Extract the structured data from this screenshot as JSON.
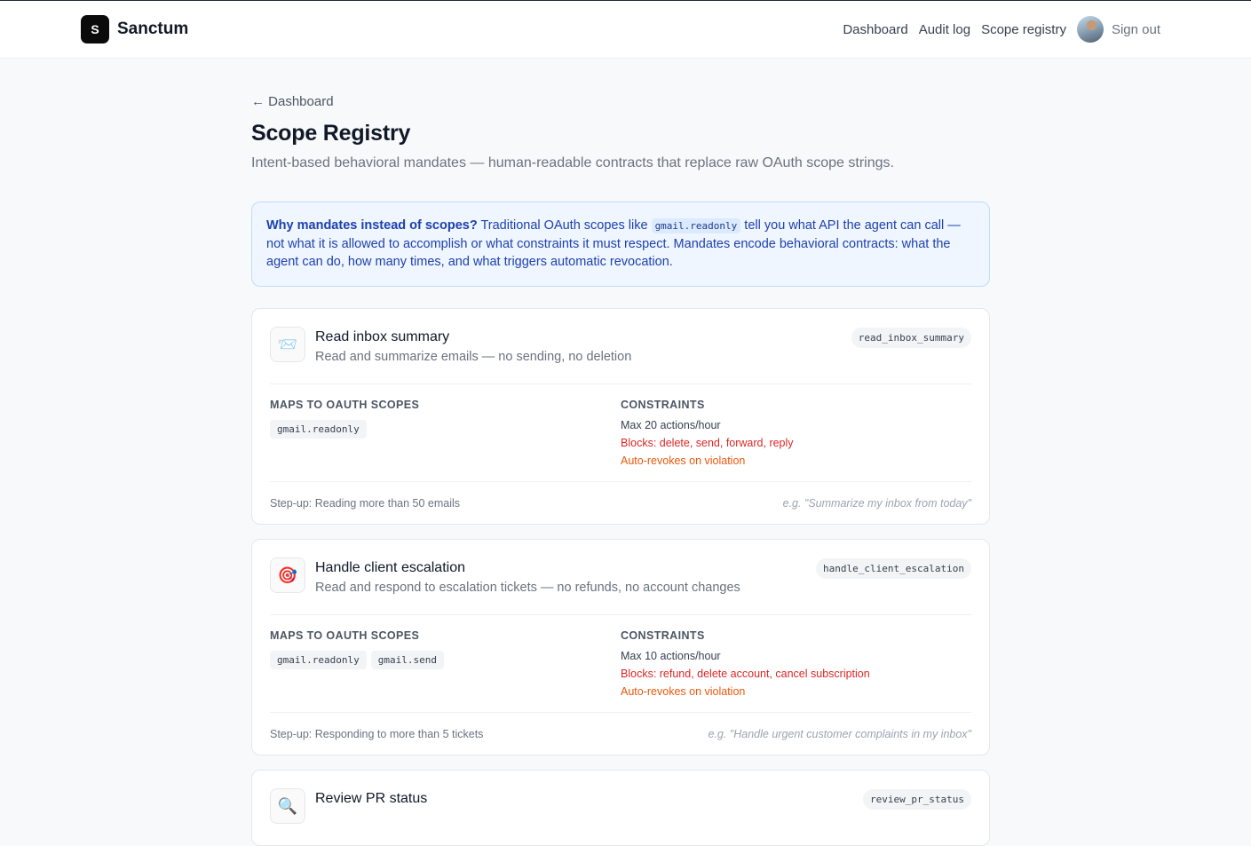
{
  "header": {
    "brand_mark": "S",
    "brand_name": "Sanctum",
    "nav": [
      "Dashboard",
      "Audit log",
      "Scope registry"
    ],
    "sign_out": "Sign out"
  },
  "page": {
    "back_link": "← Dashboard",
    "title": "Scope Registry",
    "subtitle": "Intent-based behavioral mandates — human-readable contracts that replace raw OAuth scope strings."
  },
  "info": {
    "lead": "Why mandates instead of scopes?",
    "text_1": " Traditional OAuth scopes like ",
    "code": "gmail.readonly",
    "text_2": " tell you what API the agent can call — not what it is allowed to accomplish or what constraints it must respect. Mandates encode behavioral contracts: what the agent can do, how many times, and what triggers automatic revocation."
  },
  "labels": {
    "maps_to": "MAPS TO OAUTH SCOPES",
    "constraints": "CONSTRAINTS"
  },
  "mandates": [
    {
      "icon": "📨",
      "icon_name": "incoming-envelope-icon",
      "title": "Read inbox summary",
      "description": "Read and summarize emails — no sending, no deletion",
      "slug": "read_inbox_summary",
      "scopes": [
        "gmail.readonly"
      ],
      "rate": "Max 20 actions/hour",
      "blocks": "Blocks: delete, send, forward, reply",
      "revoke": "Auto-revokes on violation",
      "step_up": "Step-up: Reading more than 50 emails",
      "example": "e.g. \"Summarize my inbox from today\""
    },
    {
      "icon": "🎯",
      "icon_name": "target-icon",
      "title": "Handle client escalation",
      "description": "Read and respond to escalation tickets — no refunds, no account changes",
      "slug": "handle_client_escalation",
      "scopes": [
        "gmail.readonly",
        "gmail.send"
      ],
      "rate": "Max 10 actions/hour",
      "blocks": "Blocks: refund, delete account, cancel subscription",
      "revoke": "Auto-revokes on violation",
      "step_up": "Step-up: Responding to more than 5 tickets",
      "example": "e.g. \"Handle urgent customer complaints in my inbox\""
    },
    {
      "icon": "🔍",
      "icon_name": "magnifying-glass-icon",
      "title": "Review PR status",
      "description": "",
      "slug": "review_pr_status"
    }
  ],
  "colors": {
    "info_bg": "#eff6ff",
    "info_border": "#bfdbfe",
    "info_text": "#1e40af",
    "block_red": "#dc2626",
    "revoke_orange": "#ea580c"
  }
}
